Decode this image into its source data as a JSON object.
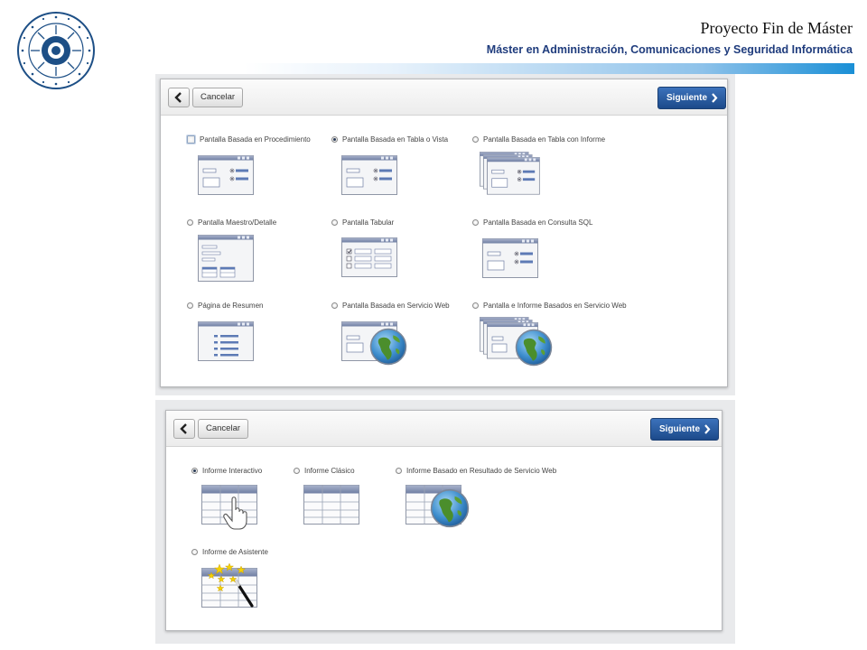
{
  "slide": {
    "title": "Proyecto Fin de Máster",
    "subtitle": "Máster en Administración, Comunicaciones y Seguridad Informática",
    "seal_text": "IN LUMINE SAPIENTIA · UNIVERSITAS ALMERIENSIS"
  },
  "wizard_page": {
    "back_icon": "chevron-left-icon",
    "cancel_label": "Cancelar",
    "next_label": "Siguiente",
    "next_icon": "chevron-right-icon",
    "options": [
      {
        "label": "Pantalla Basada en Procedimiento",
        "selected": false
      },
      {
        "label": "Pantalla Basada en Tabla o Vista",
        "selected": true
      },
      {
        "label": "Pantalla Basada en Tabla con Informe",
        "selected": false
      },
      {
        "label": "Pantalla Maestro/Detalle",
        "selected": false
      },
      {
        "label": "Pantalla Tabular",
        "selected": false
      },
      {
        "label": "Pantalla Basada en Consulta SQL",
        "selected": false
      },
      {
        "label": "Página de Resumen",
        "selected": false
      },
      {
        "label": "Pantalla Basada en Servicio Web",
        "selected": false
      },
      {
        "label": "Pantalla e Informe Basados en Servicio Web",
        "selected": false
      }
    ]
  },
  "wizard_report": {
    "back_icon": "chevron-left-icon",
    "cancel_label": "Cancelar",
    "next_label": "Siguiente",
    "next_icon": "chevron-right-icon",
    "options": [
      {
        "label": "Informe Interactivo",
        "selected": true
      },
      {
        "label": "Informe Clásico",
        "selected": false
      },
      {
        "label": "Informe Basado en Resultado de Servicio Web",
        "selected": false
      },
      {
        "label": "Informe de Asistente",
        "selected": false
      }
    ]
  },
  "colors": {
    "accent": "#1f3c7d",
    "button_blue": "#245292",
    "bar_blue": "#1a8fd6"
  }
}
